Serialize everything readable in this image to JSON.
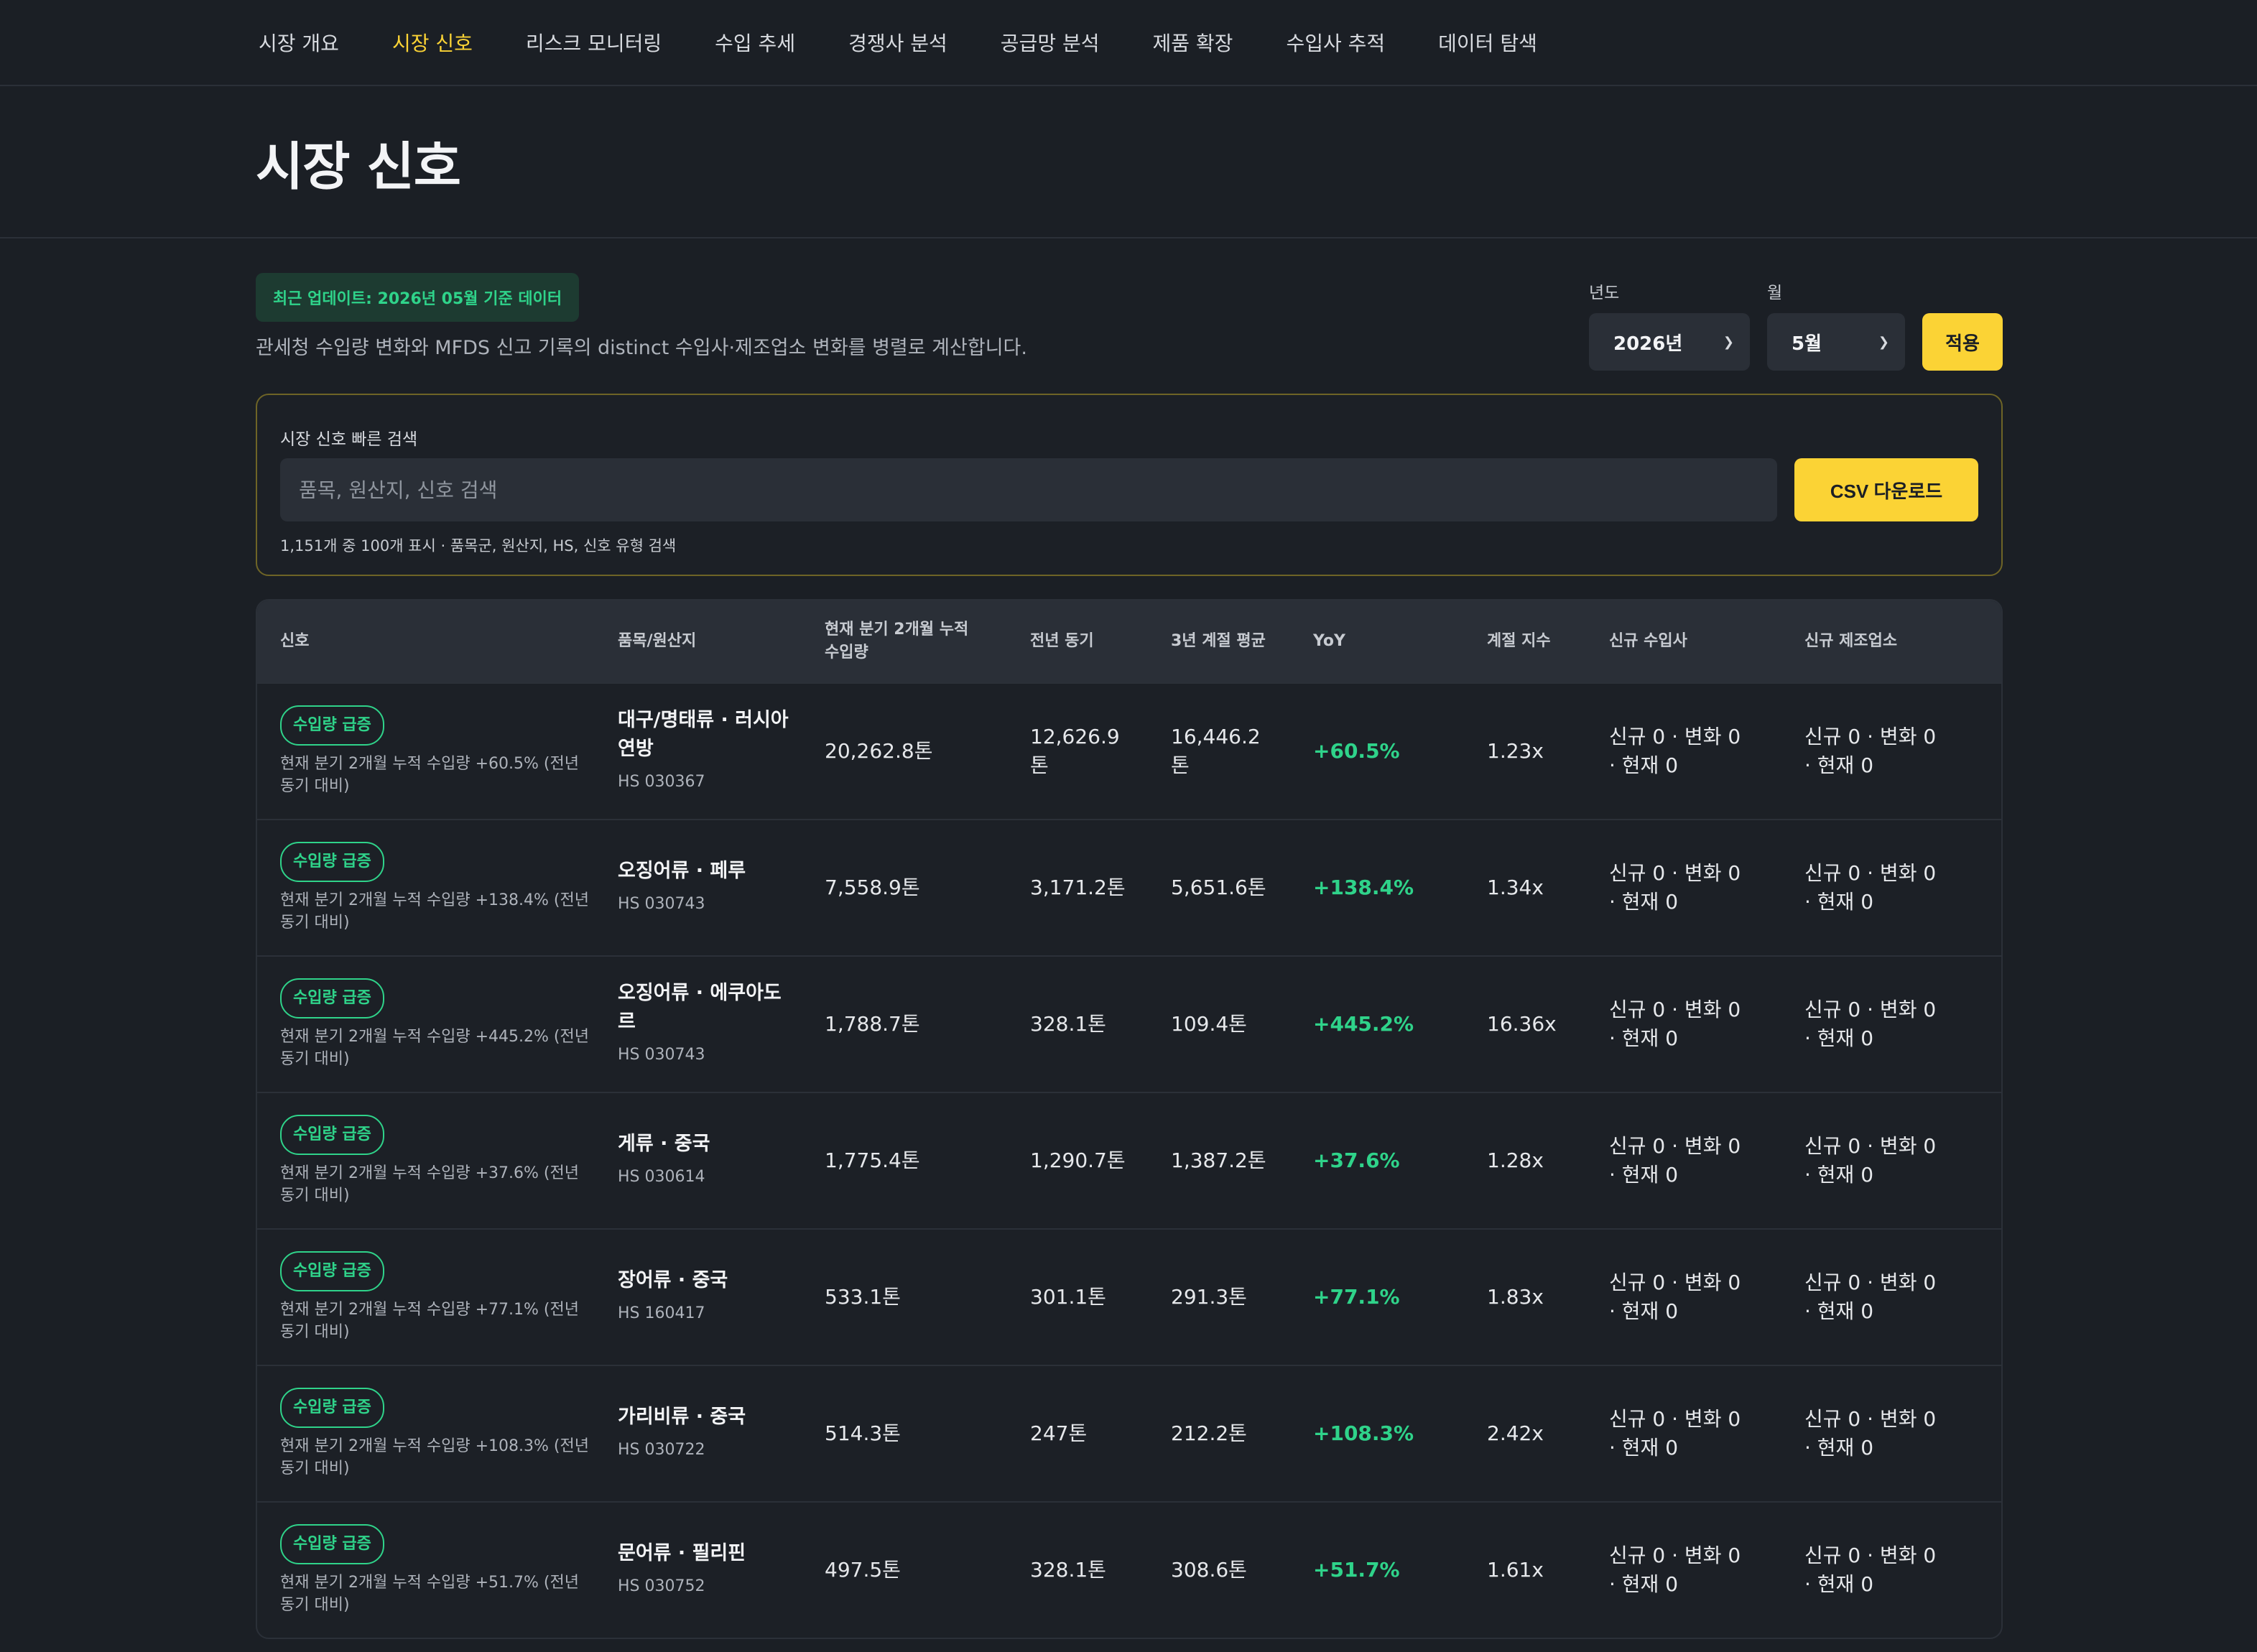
{
  "nav": {
    "items": [
      {
        "label": "시장 개요",
        "active": false
      },
      {
        "label": "시장 신호",
        "active": true
      },
      {
        "label": "리스크 모니터링",
        "active": false
      },
      {
        "label": "수입 추세",
        "active": false
      },
      {
        "label": "경쟁사 분석",
        "active": false
      },
      {
        "label": "공급망 분석",
        "active": false
      },
      {
        "label": "제품 확장",
        "active": false
      },
      {
        "label": "수입사 추적",
        "active": false
      },
      {
        "label": "데이터 탐색",
        "active": false
      }
    ]
  },
  "page": {
    "title": "시장 신호",
    "update_badge": "최근 업데이트: 2026년 05월 기준 데이터",
    "description": "관세청 수입량 변화와 MFDS 신고 기록의 distinct 수입사·제조업소 변화를 병렬로 계산합니다."
  },
  "filters": {
    "year_label": "년도",
    "year_value": "2026년",
    "month_label": "월",
    "month_value": "5월",
    "apply_label": "적용"
  },
  "search": {
    "label": "시장 신호 빠른 검색",
    "placeholder": "품목, 원산지, 신호 검색",
    "csv_label": "CSV 다운로드",
    "hint": "1,151개 중 100개 표시 · 품목군, 원산지, HS, 신호 유형 검색"
  },
  "table": {
    "headers": {
      "signal": "신호",
      "product": "품목/원산지",
      "current": "현재 분기 2개월 누적 수입량",
      "prev": "전년 동기",
      "avg": "3년 계절 평균",
      "yoy": "YoY",
      "season": "계절 지수",
      "importer": "신규 수입사",
      "maker": "신규 제조업소"
    },
    "rows": [
      {
        "badge": "수입량 급증",
        "desc": "현재 분기 2개월 누적 수입량 +60.5% (전년 동기 대비)",
        "product": "대구/명태류 · 러시아 연방",
        "hs": "HS 030367",
        "current": "20,262.8톤",
        "prev": "12,626.9톤",
        "avg": "16,446.2톤",
        "yoy": "+60.5%",
        "season": "1.23x",
        "importer": "신규 0 · 변화 0 · 현재 0",
        "maker": "신규 0 · 변화 0 · 현재 0"
      },
      {
        "badge": "수입량 급증",
        "desc": "현재 분기 2개월 누적 수입량 +138.4% (전년 동기 대비)",
        "product": "오징어류 · 페루",
        "hs": "HS 030743",
        "current": "7,558.9톤",
        "prev": "3,171.2톤",
        "avg": "5,651.6톤",
        "yoy": "+138.4%",
        "season": "1.34x",
        "importer": "신규 0 · 변화 0 · 현재 0",
        "maker": "신규 0 · 변화 0 · 현재 0"
      },
      {
        "badge": "수입량 급증",
        "desc": "현재 분기 2개월 누적 수입량 +445.2% (전년 동기 대비)",
        "product": "오징어류 · 에쿠아도르",
        "hs": "HS 030743",
        "current": "1,788.7톤",
        "prev": "328.1톤",
        "avg": "109.4톤",
        "yoy": "+445.2%",
        "season": "16.36x",
        "importer": "신규 0 · 변화 0 · 현재 0",
        "maker": "신규 0 · 변화 0 · 현재 0"
      },
      {
        "badge": "수입량 급증",
        "desc": "현재 분기 2개월 누적 수입량 +37.6% (전년 동기 대비)",
        "product": "게류 · 중국",
        "hs": "HS 030614",
        "current": "1,775.4톤",
        "prev": "1,290.7톤",
        "avg": "1,387.2톤",
        "yoy": "+37.6%",
        "season": "1.28x",
        "importer": "신규 0 · 변화 0 · 현재 0",
        "maker": "신규 0 · 변화 0 · 현재 0"
      },
      {
        "badge": "수입량 급증",
        "desc": "현재 분기 2개월 누적 수입량 +77.1% (전년 동기 대비)",
        "product": "장어류 · 중국",
        "hs": "HS 160417",
        "current": "533.1톤",
        "prev": "301.1톤",
        "avg": "291.3톤",
        "yoy": "+77.1%",
        "season": "1.83x",
        "importer": "신규 0 · 변화 0 · 현재 0",
        "maker": "신규 0 · 변화 0 · 현재 0"
      },
      {
        "badge": "수입량 급증",
        "desc": "현재 분기 2개월 누적 수입량 +108.3% (전년 동기 대비)",
        "product": "가리비류 · 중국",
        "hs": "HS 030722",
        "current": "514.3톤",
        "prev": "247톤",
        "avg": "212.2톤",
        "yoy": "+108.3%",
        "season": "2.42x",
        "importer": "신규 0 · 변화 0 · 현재 0",
        "maker": "신규 0 · 변화 0 · 현재 0"
      },
      {
        "badge": "수입량 급증",
        "desc": "현재 분기 2개월 누적 수입량 +51.7% (전년 동기 대비)",
        "product": "문어류 · 필리핀",
        "hs": "HS 030752",
        "current": "497.5톤",
        "prev": "328.1톤",
        "avg": "308.6톤",
        "yoy": "+51.7%",
        "season": "1.61x",
        "importer": "신규 0 · 변화 0 · 현재 0",
        "maker": "신규 0 · 변화 0 · 현재 0"
      }
    ]
  },
  "colors": {
    "accent": "#fbd335",
    "positive": "#2fd38a",
    "background": "#1b1f25"
  }
}
